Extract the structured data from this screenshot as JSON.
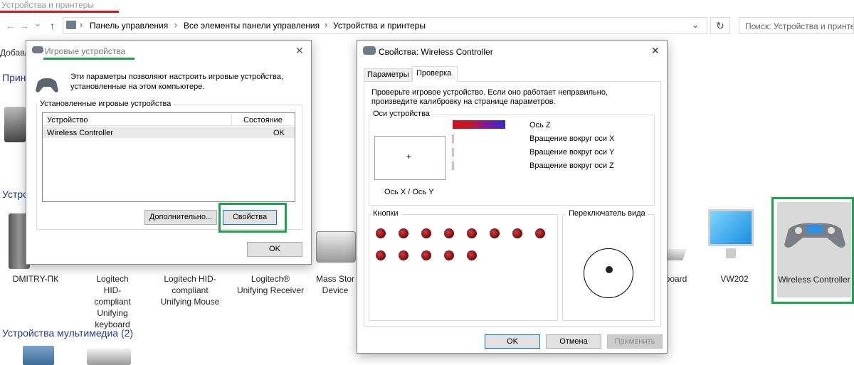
{
  "explorer": {
    "window_title": "Устройства и принтеры",
    "nav": {
      "back": "←",
      "forward": "→",
      "recent": "⌄",
      "up": "↑"
    },
    "breadcrumbs": [
      "Панель управления",
      "Все элементы панели управления",
      "Устройства и принтеры"
    ],
    "search_placeholder": "Поиск: Устройства и принте",
    "toolbar_text": "Добавл",
    "sections": {
      "printers": "Прин",
      "devices": "Устро",
      "multimedia": "Устройства мультимедиа (2)"
    },
    "devices": [
      {
        "label": "DMITRY-ПК"
      },
      {
        "label": "Logitech HID-compliant Unifying keyboard"
      },
      {
        "label": "Logitech HID-compliant Unifying Mouse"
      },
      {
        "label": "Logitech® Unifying Receiver"
      },
      {
        "label": "Mass Stor Device"
      },
      {
        "label": "board"
      },
      {
        "label": "VW202"
      },
      {
        "label": "Wireless Controller"
      }
    ]
  },
  "game_dialog": {
    "title": "Игровые устройства",
    "description": "Эти параметры позволяют настроить игровые устройства, установленные на этом компьютере.",
    "group_label": "Установленные игровые устройства",
    "columns": [
      "Устройство",
      "Состояние"
    ],
    "rows": [
      {
        "device": "Wireless Controller",
        "status": "OK"
      }
    ],
    "advanced_button": "Дополнительно...",
    "properties_button": "Свойства",
    "ok_button": "OK"
  },
  "props_dialog": {
    "title": "Свойства: Wireless Controller",
    "tabs": [
      "Параметры",
      "Проверка"
    ],
    "active_tab": "Проверка",
    "instruction": "Проверьте игровое устройство. Если оно работает неправильно, произведите калибровку на странице параметров.",
    "axes_group": "Оси устройства",
    "axis_xy_label": "Ось X / Ось Y",
    "axis_labels": [
      "Ось Z",
      "Вращение вокруг оси X",
      "Вращение вокруг оси Y",
      "Вращение вокруг оси Z"
    ],
    "buttons_group": "Кнопки",
    "button_count": 13,
    "pov_group": "Переключатель вида",
    "ok_button": "OK",
    "cancel_button": "Отмена",
    "apply_button": "Применить"
  },
  "colors": {
    "highlight_green": "#1fa34a",
    "title_red": "#d8141a",
    "button_red": "#a01818"
  }
}
